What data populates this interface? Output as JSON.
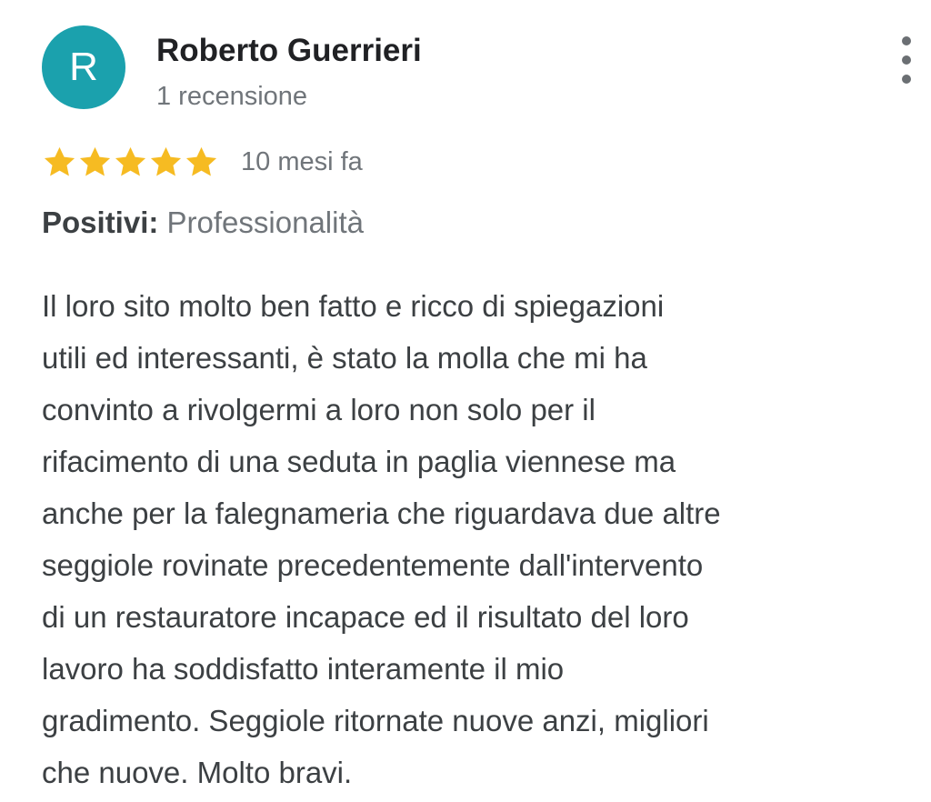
{
  "reviewer": {
    "initial": "R",
    "name": "Roberto Guerrieri",
    "review_count": "1 recensione",
    "avatar_color": "#1ba1ad"
  },
  "menu": {
    "icon": "more-vert-icon"
  },
  "rating": {
    "stars": 5,
    "max_stars": 5,
    "star_color": "#f6bb22",
    "date": "10 mesi fa"
  },
  "positives": {
    "label": "Positivi:",
    "value": "Professionalità"
  },
  "review_lines": [
    "Il loro sito molto ben fatto e ricco di spiegazioni",
    "utili ed interessanti, è stato la molla che mi ha",
    "convinto a rivolgermi a loro non solo per il",
    "rifacimento di una seduta in paglia viennese ma",
    "anche per la falegnameria che riguardava due altre",
    "seggiole rovinate precedentemente dall'intervento",
    "di un restauratore incapace ed il risultato del loro",
    "lavoro ha soddisfatto interamente il mio",
    "gradimento. Seggiole ritornate nuove anzi, migliori",
    "che nuove. Molto bravi."
  ]
}
